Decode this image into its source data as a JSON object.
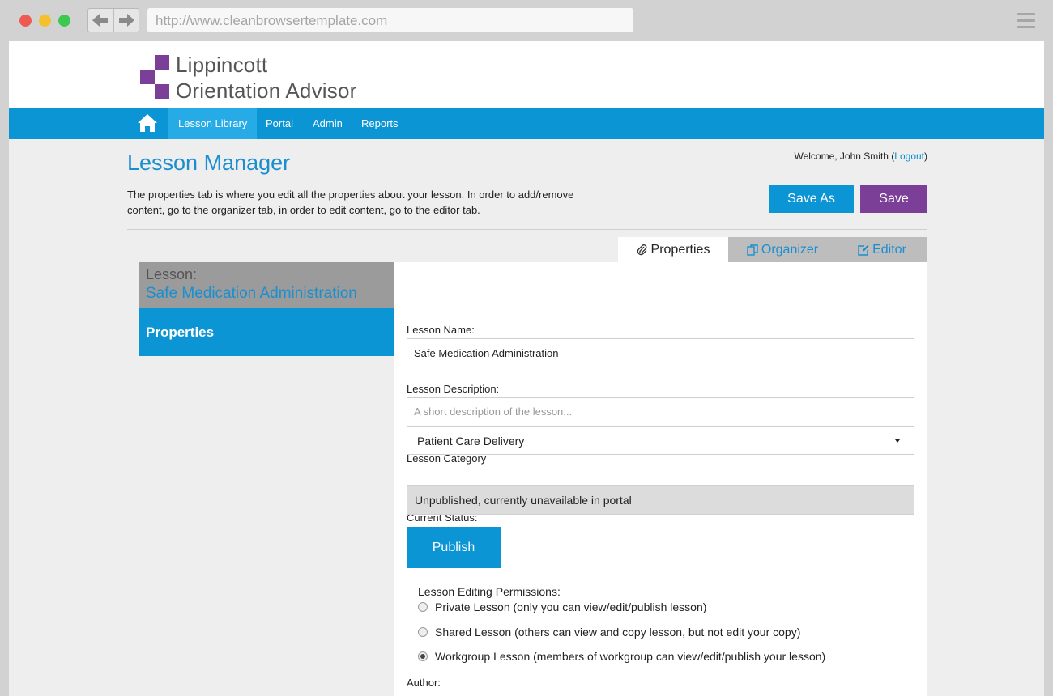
{
  "browser": {
    "url": "http://www.cleanbrowsertemplate.com",
    "back_icon": "arrow-left-icon",
    "forward_icon": "arrow-right-icon",
    "menu_icon": "hamburger-icon"
  },
  "brand": {
    "line1": "Lippincott",
    "line2": "Orientation Advisor",
    "color": "#7b3f97"
  },
  "nav": {
    "home_icon": "home-icon",
    "items": [
      {
        "label": "Lesson Library",
        "active": true
      },
      {
        "label": "Portal",
        "active": false
      },
      {
        "label": "Admin",
        "active": false
      },
      {
        "label": "Reports",
        "active": false
      }
    ],
    "color": "#0b95d5"
  },
  "user": {
    "welcome": "Welcome, John Smith (",
    "logout": "Logout",
    "close": ")"
  },
  "page": {
    "title": "Lesson Manager",
    "intro": "The properties tab is where you edit all the properties about your lesson. In order to add/remove content, go to the organizer tab, in order to edit content, go to the editor tab.",
    "save_as": "Save As",
    "save": "Save"
  },
  "tabs": [
    {
      "label": "Properties",
      "icon": "paperclip-icon",
      "active": true
    },
    {
      "label": "Organizer",
      "icon": "copy-icon",
      "active": false
    },
    {
      "label": "Editor",
      "icon": "edit-icon",
      "active": false
    }
  ],
  "sidebar": {
    "lesson_label": "Lesson:",
    "lesson_name": "Safe Medication Administration",
    "section": "Properties"
  },
  "form": {
    "name_label": "Lesson Name:",
    "name_value": "Safe Medication Administration",
    "desc_label": "Lesson Description:",
    "desc_placeholder": "A short description of the lesson...",
    "category_label": "Lesson Category",
    "category_value": "Patient Care Delivery",
    "status_label": "Current Status:",
    "status_value": "Unpublished, currently unavailable in portal",
    "publish": "Publish",
    "permissions_label": "Lesson Editing Permissions:",
    "permissions": [
      {
        "label": "Private Lesson (only you can view/edit/publish lesson)",
        "selected": false
      },
      {
        "label": "Shared Lesson (others can view and copy lesson, but not edit your copy)",
        "selected": false
      },
      {
        "label": "Workgroup Lesson (members of workgroup can view/edit/publish your lesson)",
        "selected": true
      }
    ],
    "author_label": "Author:"
  }
}
